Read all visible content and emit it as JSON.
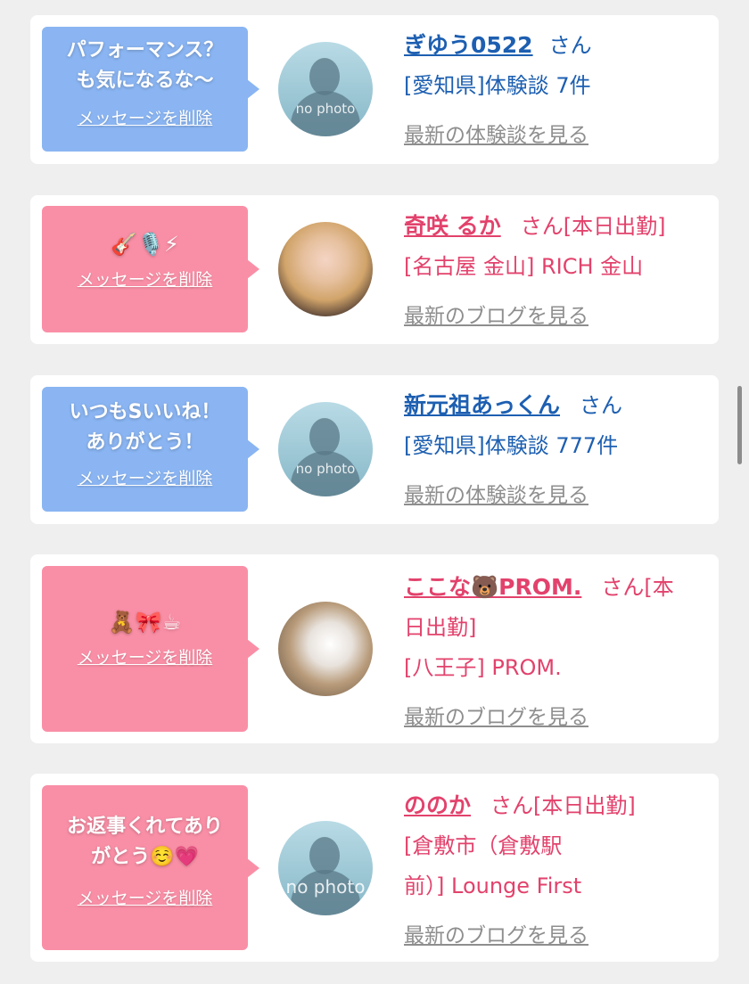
{
  "cards": [
    {
      "message": "パフォーマンス？\nも気になるな〜",
      "delete_label": "メッセージを削除",
      "avatar_text": "no photo",
      "name": "ぎゆう0522",
      "san": "さん",
      "detail": "[愛知県]体験談 7件",
      "latest": "最新の体験談を見る"
    },
    {
      "message": "🎸🎙️⚡",
      "delete_label": "メッセージを削除",
      "name": "奇咲 るか",
      "san": "さん[本日出勤]",
      "detail": "[名古屋 金山] RICH 金山",
      "latest": "最新のブログを見る"
    },
    {
      "message": "いつもSいいね！\nありがとう！",
      "delete_label": "メッセージを削除",
      "avatar_text": "no photo",
      "name": "新元祖あっくん",
      "san": "さん",
      "detail": "[愛知県]体験談 777件",
      "latest": "最新の体験談を見る"
    },
    {
      "message": "🧸🎀☕",
      "delete_label": "メッセージを削除",
      "name": "ここな🐻PROM.",
      "san": "さん[本",
      "san_line2": "日出勤]",
      "detail": "[八王子] PROM.",
      "latest": "最新のブログを見る"
    },
    {
      "message": "お返事くれてあり\nがとう☺️💗",
      "delete_label": "メッセージを削除",
      "avatar_text": "no photo",
      "name": "ののか",
      "san": "さん[本日出勤]",
      "detail": "[倉敷市（倉敷駅",
      "detail_line2": "前）] Lounge First",
      "latest": "最新のブログを見る"
    }
  ]
}
